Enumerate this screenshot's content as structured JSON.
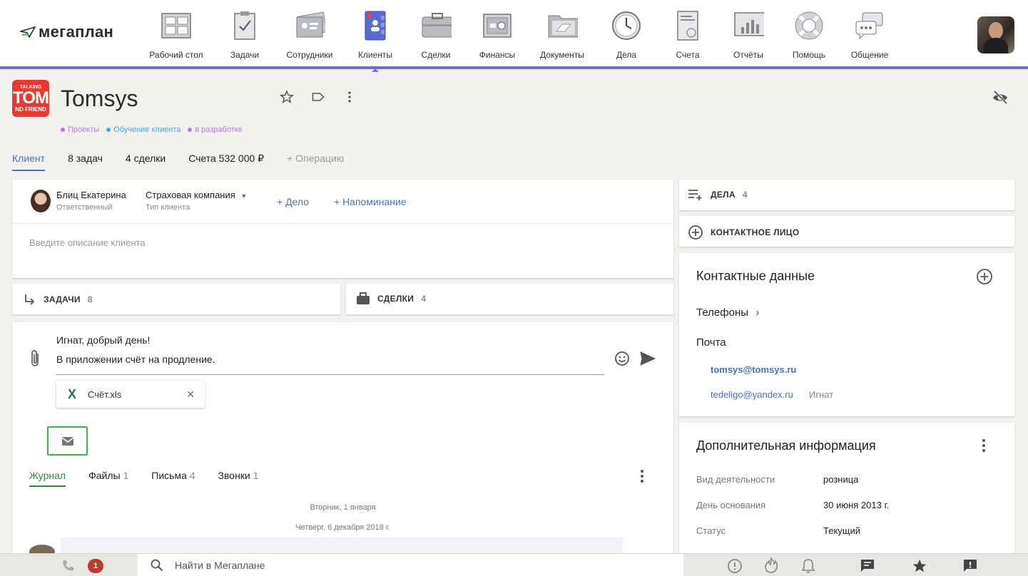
{
  "app": {
    "logo_text": "мегаплан"
  },
  "nav": [
    {
      "label": "Рабочий стол",
      "icon": "dashboard-icon"
    },
    {
      "label": "Задачи",
      "icon": "tasks-icon"
    },
    {
      "label": "Сотрудники",
      "icon": "employees-icon"
    },
    {
      "label": "Клиенты",
      "icon": "clients-icon"
    },
    {
      "label": "Сделки",
      "icon": "deals-icon"
    },
    {
      "label": "Финансы",
      "icon": "finance-icon"
    },
    {
      "label": "Документы",
      "icon": "documents-icon"
    },
    {
      "label": "Дела",
      "icon": "clock-icon"
    },
    {
      "label": "Счета",
      "icon": "invoice-icon"
    },
    {
      "label": "Отчёты",
      "icon": "reports-icon"
    },
    {
      "label": "Помощь",
      "icon": "lifebuoy-icon"
    },
    {
      "label": "Общение",
      "icon": "chat-icon"
    }
  ],
  "client": {
    "name": "Tomsys",
    "logo_text_top": "TALKING",
    "logo_text_mid": "TOM",
    "logo_text_bot": "ND FRIEND",
    "tags": [
      {
        "label": "Проекты",
        "color": "#b07cd8"
      },
      {
        "label": "Обучение клиента",
        "color": "#4aa5e0"
      },
      {
        "label": "в разработке",
        "color": "#b07cd8"
      }
    ]
  },
  "tabs": [
    {
      "label": "Клиент",
      "state": "active"
    },
    {
      "label": "8 задач",
      "state": ""
    },
    {
      "label": "4 сделки",
      "state": ""
    },
    {
      "label": "Счета 532 000 ₽",
      "state": ""
    },
    {
      "label": "+ Операцию",
      "state": "muted"
    }
  ],
  "responsible": {
    "name": "Блиц Екатерина",
    "role": "Ответственный"
  },
  "client_type": {
    "value": "Страховая компания",
    "label": "Тип клиента"
  },
  "actions": {
    "add_case": "+ Дело",
    "add_reminder": "+ Напоминание"
  },
  "description_placeholder": "Введите описание клиента",
  "sections": {
    "tasks": {
      "label": "ЗАДАЧИ",
      "count": "8"
    },
    "deals": {
      "label": "СДЕЛКИ",
      "count": "4"
    },
    "cases": {
      "label": "ДЕЛА",
      "count": "4"
    },
    "contact_person": {
      "label": "КОНТАКТНОЕ ЛИЦО"
    }
  },
  "message": {
    "line1": "Игнат, добрый день!",
    "line2": "В приложении счёт на продление.",
    "attachment": "Счёт.xls"
  },
  "journal_tabs": [
    {
      "label": "Журнал",
      "count": "",
      "state": "active"
    },
    {
      "label": "Файлы",
      "count": "1",
      "state": ""
    },
    {
      "label": "Письма",
      "count": "4",
      "state": ""
    },
    {
      "label": "Звонки",
      "count": "1",
      "state": ""
    }
  ],
  "feed": {
    "date1": "Вторник, 1 января",
    "date2": "Четверг, 6 декабря 2018 г."
  },
  "contacts": {
    "title": "Контактные данные",
    "phones": "Телефоны",
    "mail": "Почта",
    "email1": "tomsys@tomsys.ru",
    "email2": "tedeligo@yandex.ru",
    "email2_note": "Игнат"
  },
  "extra_info": {
    "title": "Дополнительная информация",
    "rows": [
      {
        "key": "Вид деятельности",
        "value": "розница"
      },
      {
        "key": "День основания",
        "value": "30 июня 2013 г."
      },
      {
        "key": "Статус",
        "value": "Текущий"
      }
    ]
  },
  "bottom": {
    "search_placeholder": "Найти в Мегаплане",
    "missed_calls": "1"
  }
}
